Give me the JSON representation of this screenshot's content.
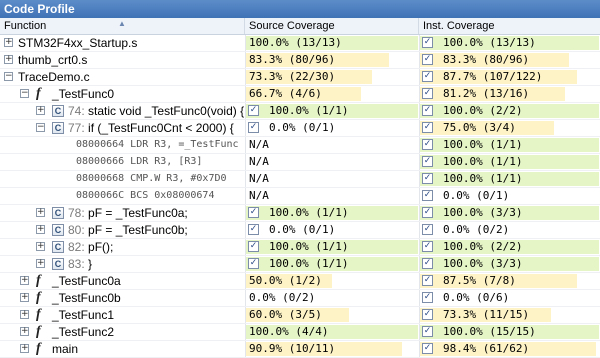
{
  "window": {
    "title": "Code Profile"
  },
  "columns": {
    "function": "Function",
    "source": "Source Coverage",
    "inst": "Inst. Coverage"
  },
  "rows": [
    {
      "expander": "+",
      "indent": 0,
      "icon": "none",
      "lineno": "",
      "text": "STM32F4xx_Startup.s",
      "mono": false,
      "src": "100.0% (13/13)",
      "src_cov": 1.0,
      "src_checked": false,
      "inst": "100.0% (13/13)",
      "inst_cov": 1.0
    },
    {
      "expander": "+",
      "indent": 0,
      "icon": "none",
      "lineno": "",
      "text": "thumb_crt0.s",
      "mono": false,
      "src": "83.3% (80/96)",
      "src_cov": 0.833,
      "src_checked": false,
      "inst": "83.3% (80/96)",
      "inst_cov": 0.833
    },
    {
      "expander": "−",
      "indent": 0,
      "icon": "none",
      "lineno": "",
      "text": "TraceDemo.c",
      "mono": false,
      "src": "73.3% (22/30)",
      "src_cov": 0.733,
      "src_checked": false,
      "inst": "87.7% (107/122)",
      "inst_cov": 0.877
    },
    {
      "expander": "−",
      "indent": 1,
      "icon": "f",
      "lineno": "",
      "text": "_TestFunc0",
      "mono": false,
      "src": "66.7% (4/6)",
      "src_cov": 0.667,
      "src_checked": false,
      "inst": "81.2% (13/16)",
      "inst_cov": 0.812
    },
    {
      "expander": "+",
      "indent": 2,
      "icon": "c",
      "lineno": "74:",
      "text": "static void _TestFunc0(void) {",
      "mono": false,
      "src": "100.0% (1/1)",
      "src_cov": 1.0,
      "src_checked": true,
      "inst": "100.0% (2/2)",
      "inst_cov": 1.0
    },
    {
      "expander": "−",
      "indent": 2,
      "icon": "c",
      "lineno": "77:",
      "text": "if (_TestFunc0Cnt < 2000) {",
      "mono": false,
      "src": "0.0% (0/1)",
      "src_cov": 0.0,
      "src_checked": true,
      "inst": "75.0% (3/4)",
      "inst_cov": 0.75
    },
    {
      "expander": "",
      "indent": 3,
      "icon": "none",
      "lineno": "",
      "text": "08000664  LDR R3, =_TestFunc",
      "mono": true,
      "src": "N/A",
      "src_cov": -1,
      "src_checked": false,
      "inst": "100.0% (1/1)",
      "inst_cov": 1.0
    },
    {
      "expander": "",
      "indent": 3,
      "icon": "none",
      "lineno": "",
      "text": "08000666  LDR R3, [R3]",
      "mono": true,
      "src": "N/A",
      "src_cov": -1,
      "src_checked": false,
      "inst": "100.0% (1/1)",
      "inst_cov": 1.0
    },
    {
      "expander": "",
      "indent": 3,
      "icon": "none",
      "lineno": "",
      "text": "08000668  CMP.W R3, #0x7D0",
      "mono": true,
      "src": "N/A",
      "src_cov": -1,
      "src_checked": false,
      "inst": "100.0% (1/1)",
      "inst_cov": 1.0
    },
    {
      "expander": "",
      "indent": 3,
      "icon": "none",
      "lineno": "",
      "text": "0800066C  BCS 0x08000674",
      "mono": true,
      "src": "N/A",
      "src_cov": -1,
      "src_checked": false,
      "inst": "0.0% (0/1)",
      "inst_cov": 0.0
    },
    {
      "expander": "+",
      "indent": 2,
      "icon": "c",
      "lineno": "78:",
      "text": "pF = _TestFunc0a;",
      "mono": false,
      "src": "100.0% (1/1)",
      "src_cov": 1.0,
      "src_checked": true,
      "inst": "100.0% (3/3)",
      "inst_cov": 1.0
    },
    {
      "expander": "+",
      "indent": 2,
      "icon": "c",
      "lineno": "80:",
      "text": "pF = _TestFunc0b;",
      "mono": false,
      "src": "0.0% (0/1)",
      "src_cov": 0.0,
      "src_checked": true,
      "inst": "0.0% (0/2)",
      "inst_cov": 0.0
    },
    {
      "expander": "+",
      "indent": 2,
      "icon": "c",
      "lineno": "82:",
      "text": "pF();",
      "mono": false,
      "src": "100.0% (1/1)",
      "src_cov": 1.0,
      "src_checked": true,
      "inst": "100.0% (2/2)",
      "inst_cov": 1.0
    },
    {
      "expander": "+",
      "indent": 2,
      "icon": "c",
      "lineno": "83:",
      "text": "}",
      "mono": false,
      "src": "100.0% (1/1)",
      "src_cov": 1.0,
      "src_checked": true,
      "inst": "100.0% (3/3)",
      "inst_cov": 1.0
    },
    {
      "expander": "+",
      "indent": 1,
      "icon": "f",
      "lineno": "",
      "text": "_TestFunc0a",
      "mono": false,
      "src": "50.0% (1/2)",
      "src_cov": 0.5,
      "src_checked": false,
      "inst": "87.5% (7/8)",
      "inst_cov": 0.875
    },
    {
      "expander": "+",
      "indent": 1,
      "icon": "f",
      "lineno": "",
      "text": "_TestFunc0b",
      "mono": false,
      "src": "0.0% (0/2)",
      "src_cov": 0.0,
      "src_checked": false,
      "inst": "0.0% (0/6)",
      "inst_cov": 0.0
    },
    {
      "expander": "+",
      "indent": 1,
      "icon": "f",
      "lineno": "",
      "text": "_TestFunc1",
      "mono": false,
      "src": "60.0% (3/5)",
      "src_cov": 0.6,
      "src_checked": false,
      "inst": "73.3% (11/15)",
      "inst_cov": 0.733
    },
    {
      "expander": "+",
      "indent": 1,
      "icon": "f",
      "lineno": "",
      "text": "_TestFunc2",
      "mono": false,
      "src": "100.0% (4/4)",
      "src_cov": 1.0,
      "src_checked": false,
      "inst": "100.0% (15/15)",
      "inst_cov": 1.0
    },
    {
      "expander": "+",
      "indent": 1,
      "icon": "f",
      "lineno": "",
      "text": "main",
      "mono": false,
      "src": "90.9% (10/11)",
      "src_cov": 0.909,
      "src_checked": false,
      "inst": "98.4% (61/62)",
      "inst_cov": 0.984
    }
  ]
}
